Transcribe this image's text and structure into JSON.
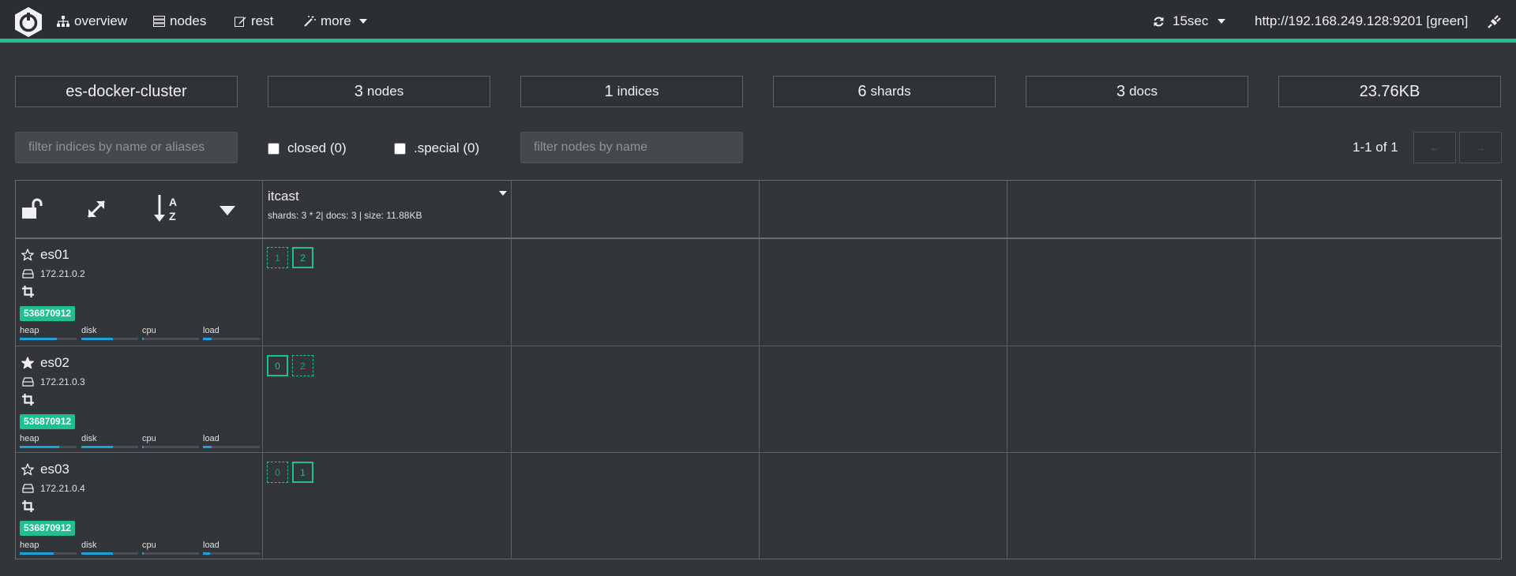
{
  "nav": {
    "overview": "overview",
    "nodes": "nodes",
    "rest": "rest",
    "more": "more",
    "refresh": "15sec",
    "cluster_url": "http://192.168.249.128:9201 [green]"
  },
  "colors": {
    "accent": "#1fbf8f",
    "metric_bar": "#1ba1e2",
    "background": "#32363a"
  },
  "stats": {
    "cluster_name": "es-docker-cluster",
    "nodes_count": "3",
    "nodes_label": "nodes",
    "indices_count": "1",
    "indices_label": "indices",
    "shards_count": "6",
    "shards_label": "shards",
    "docs_count": "3",
    "docs_label": "docs",
    "size": "23.76KB"
  },
  "filters": {
    "indices_placeholder": "filter indices by name or aliases",
    "closed_label": "closed (0)",
    "special_label": ".special (0)",
    "nodes_placeholder": "filter nodes by name"
  },
  "pager": {
    "text": "1-1 of 1",
    "prev": "←",
    "next": "→"
  },
  "index": {
    "name": "itcast",
    "meta": "shards: 3 * 2| docs: 3 | size: 11.88KB"
  },
  "nodes": [
    {
      "name": "es01",
      "ip": "172.21.0.2",
      "badge": "536870912",
      "master": false,
      "metrics": [
        {
          "label": "heap",
          "level": 0.65
        },
        {
          "label": "disk",
          "level": 0.55
        },
        {
          "label": "cpu",
          "level": 0.03
        },
        {
          "label": "load",
          "level": 0.15
        }
      ],
      "shards": [
        {
          "id": "1",
          "primary": false
        },
        {
          "id": "2",
          "primary": true
        }
      ]
    },
    {
      "name": "es02",
      "ip": "172.21.0.3",
      "badge": "536870912",
      "master": true,
      "metrics": [
        {
          "label": "heap",
          "level": 0.7
        },
        {
          "label": "disk",
          "level": 0.55
        },
        {
          "label": "cpu",
          "level": 0.03
        },
        {
          "label": "load",
          "level": 0.15
        }
      ],
      "shards": [
        {
          "id": "0",
          "primary": true
        },
        {
          "id": "2",
          "primary": false
        }
      ]
    },
    {
      "name": "es03",
      "ip": "172.21.0.4",
      "badge": "536870912",
      "master": false,
      "metrics": [
        {
          "label": "heap",
          "level": 0.6
        },
        {
          "label": "disk",
          "level": 0.55
        },
        {
          "label": "cpu",
          "level": 0.03
        },
        {
          "label": "load",
          "level": 0.12
        }
      ],
      "shards": [
        {
          "id": "0",
          "primary": false
        },
        {
          "id": "1",
          "primary": true
        }
      ]
    }
  ]
}
